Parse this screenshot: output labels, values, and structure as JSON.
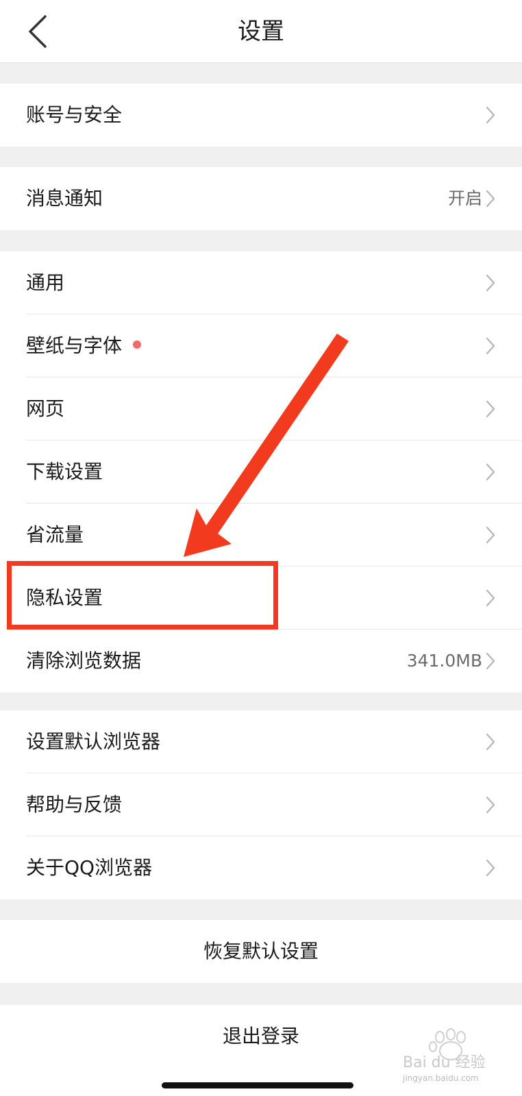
{
  "header": {
    "title": "设置"
  },
  "groups": [
    {
      "items": [
        {
          "label": "账号与安全",
          "value": ""
        }
      ]
    },
    {
      "items": [
        {
          "label": "消息通知",
          "value": "开启"
        }
      ]
    },
    {
      "items": [
        {
          "label": "通用",
          "value": ""
        },
        {
          "label": "壁纸与字体",
          "value": "",
          "badge_dot": true
        },
        {
          "label": "网页",
          "value": ""
        },
        {
          "label": "下载设置",
          "value": ""
        },
        {
          "label": "省流量",
          "value": ""
        },
        {
          "label": "隐私设置",
          "value": "",
          "highlighted": true
        },
        {
          "label": "清除浏览数据",
          "value": "341.0MB"
        }
      ]
    },
    {
      "items": [
        {
          "label": "设置默认浏览器",
          "value": ""
        },
        {
          "label": "帮助与反馈",
          "value": ""
        },
        {
          "label": "关于QQ浏览器",
          "value": ""
        }
      ]
    }
  ],
  "actions": {
    "restore_label": "恢复默认设置",
    "logout_label": "退出登录"
  },
  "watermark": {
    "text": "Bai du 经验",
    "sub": "jingyan.baidu.com"
  },
  "colors": {
    "annotation_red": "#f23b1e",
    "badge_dot": "#ef6b6b",
    "background": "#f0f0f0"
  }
}
